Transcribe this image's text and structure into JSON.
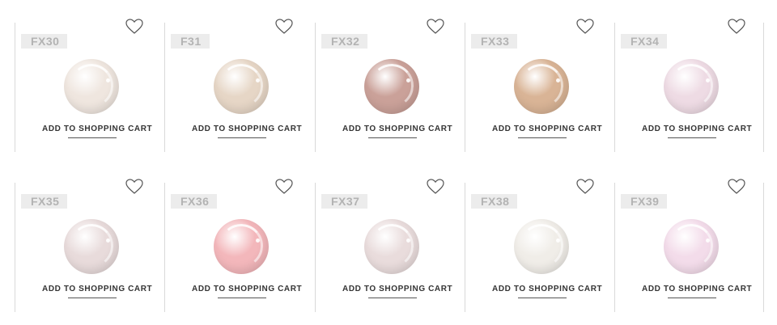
{
  "rows": [
    {
      "cards": [
        {
          "code": "FX30",
          "color": "#efe6df",
          "cart_label": "ADD TO SHOPPING CART"
        },
        {
          "code": "F31",
          "color": "#e6d6c6",
          "cart_label": "ADD TO SHOPPING CART"
        },
        {
          "code": "FX32",
          "color": "#caa199",
          "cart_label": "ADD TO SHOPPING CART"
        },
        {
          "code": "FX33",
          "color": "#d9b496",
          "cart_label": "ADD TO SHOPPING CART"
        },
        {
          "code": "FX34",
          "color": "#eedbe4",
          "cart_label": "ADD TO SHOPPING CART"
        }
      ]
    },
    {
      "cards": [
        {
          "code": "FX35",
          "color": "#e8dbdb",
          "cart_label": "ADD TO SHOPPING CART"
        },
        {
          "code": "FX36",
          "color": "#f3b7bb",
          "cart_label": "ADD TO SHOPPING CART"
        },
        {
          "code": "FX37",
          "color": "#e9dcdc",
          "cart_label": "ADD TO SHOPPING CART"
        },
        {
          "code": "FX38",
          "color": "#f0ede8",
          "cart_label": "ADD TO SHOPPING CART"
        },
        {
          "code": "FX39",
          "color": "#f3dcea",
          "cart_label": "ADD TO SHOPPING CART"
        }
      ]
    }
  ],
  "icons": {
    "favorite": "heart-outline-icon"
  },
  "colors": {
    "divider": "#d9d9d9",
    "code_bg": "#ececec",
    "code_text": "#b3b3b3",
    "cart_text": "#333333"
  }
}
